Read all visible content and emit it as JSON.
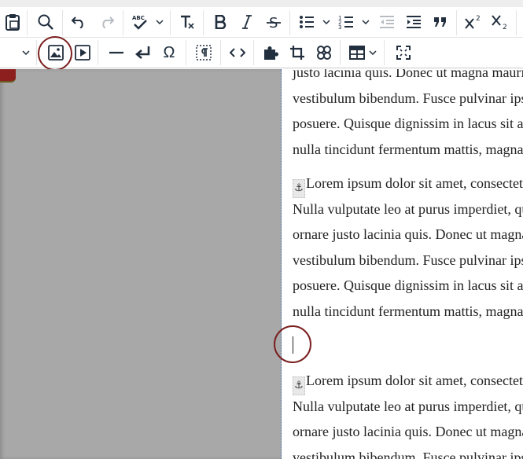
{
  "toolbar_row1": {
    "buttons": [
      {
        "name": "paste-button",
        "icon": "clipboard-icon"
      },
      {
        "name": "find-replace-button",
        "icon": "search-icon"
      },
      {
        "name": "undo-button",
        "icon": "undo-icon"
      },
      {
        "name": "redo-button",
        "icon": "redo-icon",
        "disabled": true
      },
      {
        "name": "spellcheck-button",
        "icon": "spellcheck-icon",
        "label": "ABC"
      },
      {
        "name": "clear-formatting-button",
        "icon": "clear-format-icon",
        "label": "T"
      },
      {
        "name": "bold-button",
        "icon": "bold-icon",
        "label": "B"
      },
      {
        "name": "italic-button",
        "icon": "italic-icon",
        "label": "I"
      },
      {
        "name": "strikethrough-button",
        "icon": "strikethrough-icon",
        "label": "S"
      },
      {
        "name": "bullet-list-button",
        "icon": "bullet-list-icon"
      },
      {
        "name": "numbered-list-button",
        "icon": "numbered-list-icon"
      },
      {
        "name": "outdent-button",
        "icon": "outdent-icon",
        "disabled": true
      },
      {
        "name": "indent-button",
        "icon": "indent-icon"
      },
      {
        "name": "blockquote-button",
        "icon": "blockquote-icon"
      },
      {
        "name": "superscript-button",
        "icon": "superscript-icon"
      },
      {
        "name": "subscript-button",
        "icon": "subscript-icon"
      }
    ]
  },
  "toolbar_row2": {
    "buttons": [
      {
        "name": "insert-image-button",
        "icon": "image-icon"
      },
      {
        "name": "insert-media-button",
        "icon": "media-play-icon"
      },
      {
        "name": "horizontal-line-button",
        "icon": "horizontal-line-icon"
      },
      {
        "name": "nonbreaking-button",
        "icon": "return-arrow-icon"
      },
      {
        "name": "special-character-button",
        "icon": "omega-icon",
        "label": "Ω"
      },
      {
        "name": "show-blocks-button",
        "icon": "paragraph-icon"
      },
      {
        "name": "source-code-button",
        "icon": "code-icon"
      },
      {
        "name": "plugin-button",
        "icon": "puzzle-icon"
      },
      {
        "name": "crop-button",
        "icon": "crop-icon"
      },
      {
        "name": "template-button",
        "icon": "grid-knot-icon"
      },
      {
        "name": "table-button",
        "icon": "table-icon"
      },
      {
        "name": "fullscreen-button",
        "icon": "fullscreen-icon"
      }
    ]
  },
  "editor": {
    "para_top": {
      "lines": [
        "justo lacinia quis. Donec ut magna mauris. Aliquam erat volutpat. Sed at",
        "vestibulum bibendum. Fusce pulvinar ipsum quis velit consequat, in",
        "posuere. Quisque dignissim in lacus sit amet dictum. Curabitur at",
        "nulla tincidunt fermentum mattis, magna sem dignissim sapien."
      ]
    },
    "para_middle": {
      "anchor": "⚓",
      "lines": [
        "Lorem ipsum dolor sit amet, consectetur adipiscing elit.",
        "Nulla vulputate leo at purus imperdiet, quis ultrices metus",
        "ornare justo lacinia quis. Donec ut magna mauris. Aliquam erat",
        "vestibulum bibendum. Fusce pulvinar ipsum quis velit consequat, in",
        "posuere. Quisque dignissim in lacus sit amet dictum. Curabitur at",
        "nulla tincidunt fermentum mattis, magna sem dignissim sapien."
      ]
    },
    "para_bottom": {
      "anchor": "⚓",
      "lines": [
        "Lorem ipsum dolor sit amet, consectetur adipiscing elit.",
        "Nulla vulputate leo at purus imperdiet, quis ultrices metus",
        "ornare justo lacinia quis. Donec ut magna mauris. Aliquam erat",
        "vestibulum bibendum. Fusce pulvinar ipsum quis velit consequat, in"
      ]
    }
  },
  "colors": {
    "highlight_ring": "#7a1f1f",
    "panel_gray": "#a8a8a8",
    "icon": "#222f3e"
  }
}
